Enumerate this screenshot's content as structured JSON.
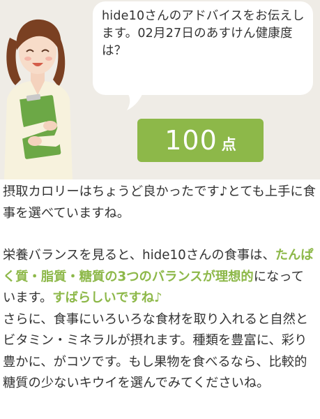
{
  "message": {
    "user": "hide10",
    "text": "hide10さんのアドバイスをお伝えします。02月27日のあすけん健康度は？"
  },
  "score": {
    "value": "100",
    "unit": "点"
  },
  "advice": {
    "p1": "摂取カロリーはちょうど良かったです♪とても上手に食事を選べていますね。",
    "p2_a": "栄養バランスを見ると、hide10さんの食事は、",
    "p2_highlight1": "たんぱく質・脂質・糖質の3つのバランスが理想的",
    "p2_b": "になっています。",
    "p2_highlight2": "すばらしいですね♪",
    "p3": "さらに、食事にいろいろな食材を取り入れると自然とビタミン・ミネラルが摂れます。種類を豊富に、彩り豊かに、がコツです。もし果物を食べるなら、比較的糖質の少ないキウイを選んでみてくださいね。"
  },
  "colors": {
    "accent_green": "#8db849",
    "panel_bg": "#efece6",
    "text": "#333333"
  },
  "icons": {
    "avatar": "advisor-woman-avatar"
  }
}
